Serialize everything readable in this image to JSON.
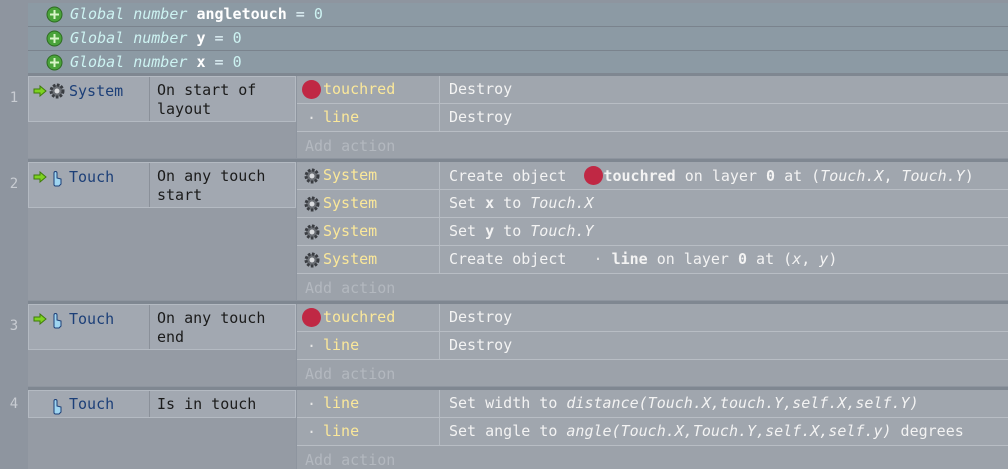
{
  "globals": [
    {
      "prefix": "Global number",
      "name": "angletouch",
      "eq": "=",
      "value": "0"
    },
    {
      "prefix": "Global number",
      "name": "y",
      "eq": "=",
      "value": "0"
    },
    {
      "prefix": "Global number",
      "name": "x",
      "eq": "=",
      "value": "0"
    }
  ],
  "events": [
    {
      "number": "1",
      "object": "System",
      "condition": "On start of layout",
      "actions": [
        {
          "object": "touchred",
          "text": "Destroy"
        },
        {
          "object": "line",
          "text": "Destroy"
        }
      ],
      "add_action": "Add action"
    },
    {
      "number": "2",
      "object": "Touch",
      "condition": "On any touch start",
      "actions": [
        {
          "object": "System",
          "text_parts": [
            "Create object ",
            "touchred",
            " on layer ",
            "0",
            " at (",
            "Touch.X",
            ", ",
            "Touch.Y",
            ")"
          ]
        },
        {
          "object": "System",
          "text_parts": [
            "Set ",
            "x",
            " to ",
            "Touch.X"
          ]
        },
        {
          "object": "System",
          "text_parts": [
            "Set ",
            "y",
            " to ",
            "Touch.Y"
          ]
        },
        {
          "object": "System",
          "text_parts": [
            "Create object ",
            "line",
            " on layer ",
            "0",
            " at (",
            "x",
            ", ",
            "y",
            ")"
          ]
        }
      ],
      "add_action": "Add action"
    },
    {
      "number": "3",
      "object": "Touch",
      "condition": "On any touch end",
      "actions": [
        {
          "object": "touchred",
          "text": "Destroy"
        },
        {
          "object": "line",
          "text": "Destroy"
        }
      ],
      "add_action": "Add action"
    },
    {
      "number": "4",
      "object": "Touch",
      "condition": "Is in touch",
      "actions": [
        {
          "object": "line",
          "text_parts": [
            "Set width to ",
            "distance(Touch.X,touch.Y,self.X,self.Y)"
          ]
        },
        {
          "object": "line",
          "text_parts": [
            "Set angle to ",
            "angle(Touch.X,Touch.Y,self.X,self.y)",
            " degrees"
          ]
        }
      ],
      "add_action": "Add action"
    }
  ],
  "colors": {
    "touchred": "#c02844",
    "object_text": "#fbe89a",
    "condition_object": "#1c3f78"
  }
}
